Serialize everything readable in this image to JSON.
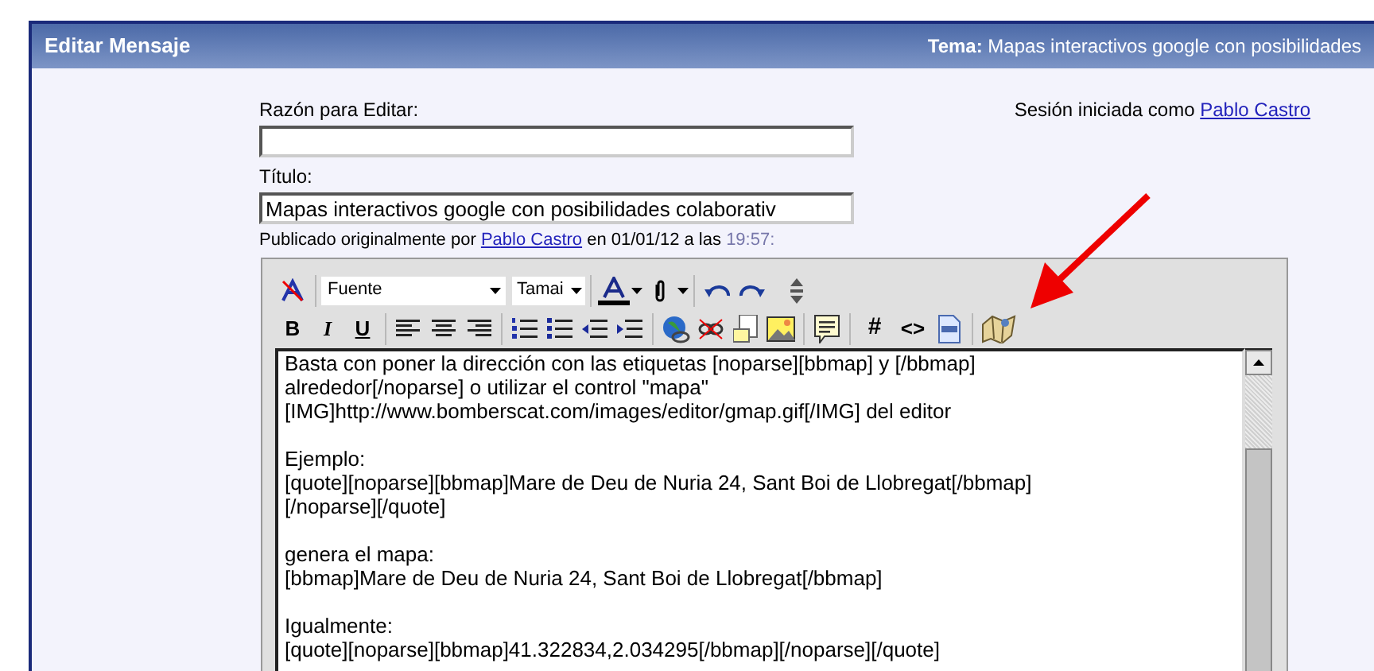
{
  "header": {
    "title": "Editar Mensaje",
    "topic": "**Tema:** Mapas interactivos google con posibilidades"
  },
  "session": {
    "text": "Sesión iniciada como",
    "user": "Pablo Castro"
  },
  "form": {
    "reason_label": "Razón para Editar:",
    "title_label": "Título:",
    "title_value": "Mapas interactivos google con posibilidades colaborativ"
  },
  "posted": {
    "prefix": "Publicado originalmente por",
    "user": "Pablo Castro",
    "middle": "en 01/01/12 a las",
    "time": "19:57:"
  },
  "toolbar": {
    "font": "Fuente",
    "size": "Tamai",
    "format_buttons": [
      {
        "label": "B",
        "kind": "bold"
      },
      {
        "label": "I",
        "kind": "italic"
      },
      {
        "label": "U",
        "kind": "underline"
      }
    ],
    "code_buttons": [
      {
        "label": "#",
        "kind": "code"
      },
      {
        "label": "<>",
        "kind": "html"
      }
    ]
  },
  "editor": {
    "paragraphs": [
      [
        "Basta con poner la dirección con las etiquetas [noparse][bbmap] y [/bbmap]",
        "alrededor[/noparse] o utilizar el control \"mapa\"",
        "[IMG]http://www.bomberscat.com/images/editor/gmap.gif[/IMG] del editor"
      ],
      [
        "Ejemplo:",
        "[quote][noparse][bbmap]Mare de Deu de Nuria 24, Sant Boi de Llobregat[/bbmap]",
        "[/noparse][/quote]"
      ],
      [
        "genera el mapa:",
        "[bbmap]Mare de Deu de Nuria 24, Sant Boi de Llobregat[/bbmap]"
      ],
      [
        "Igualmente:",
        "[quote][noparse][bbmap]41.322834,2.034295[/bbmap][/noparse][/quote]"
      ]
    ]
  }
}
